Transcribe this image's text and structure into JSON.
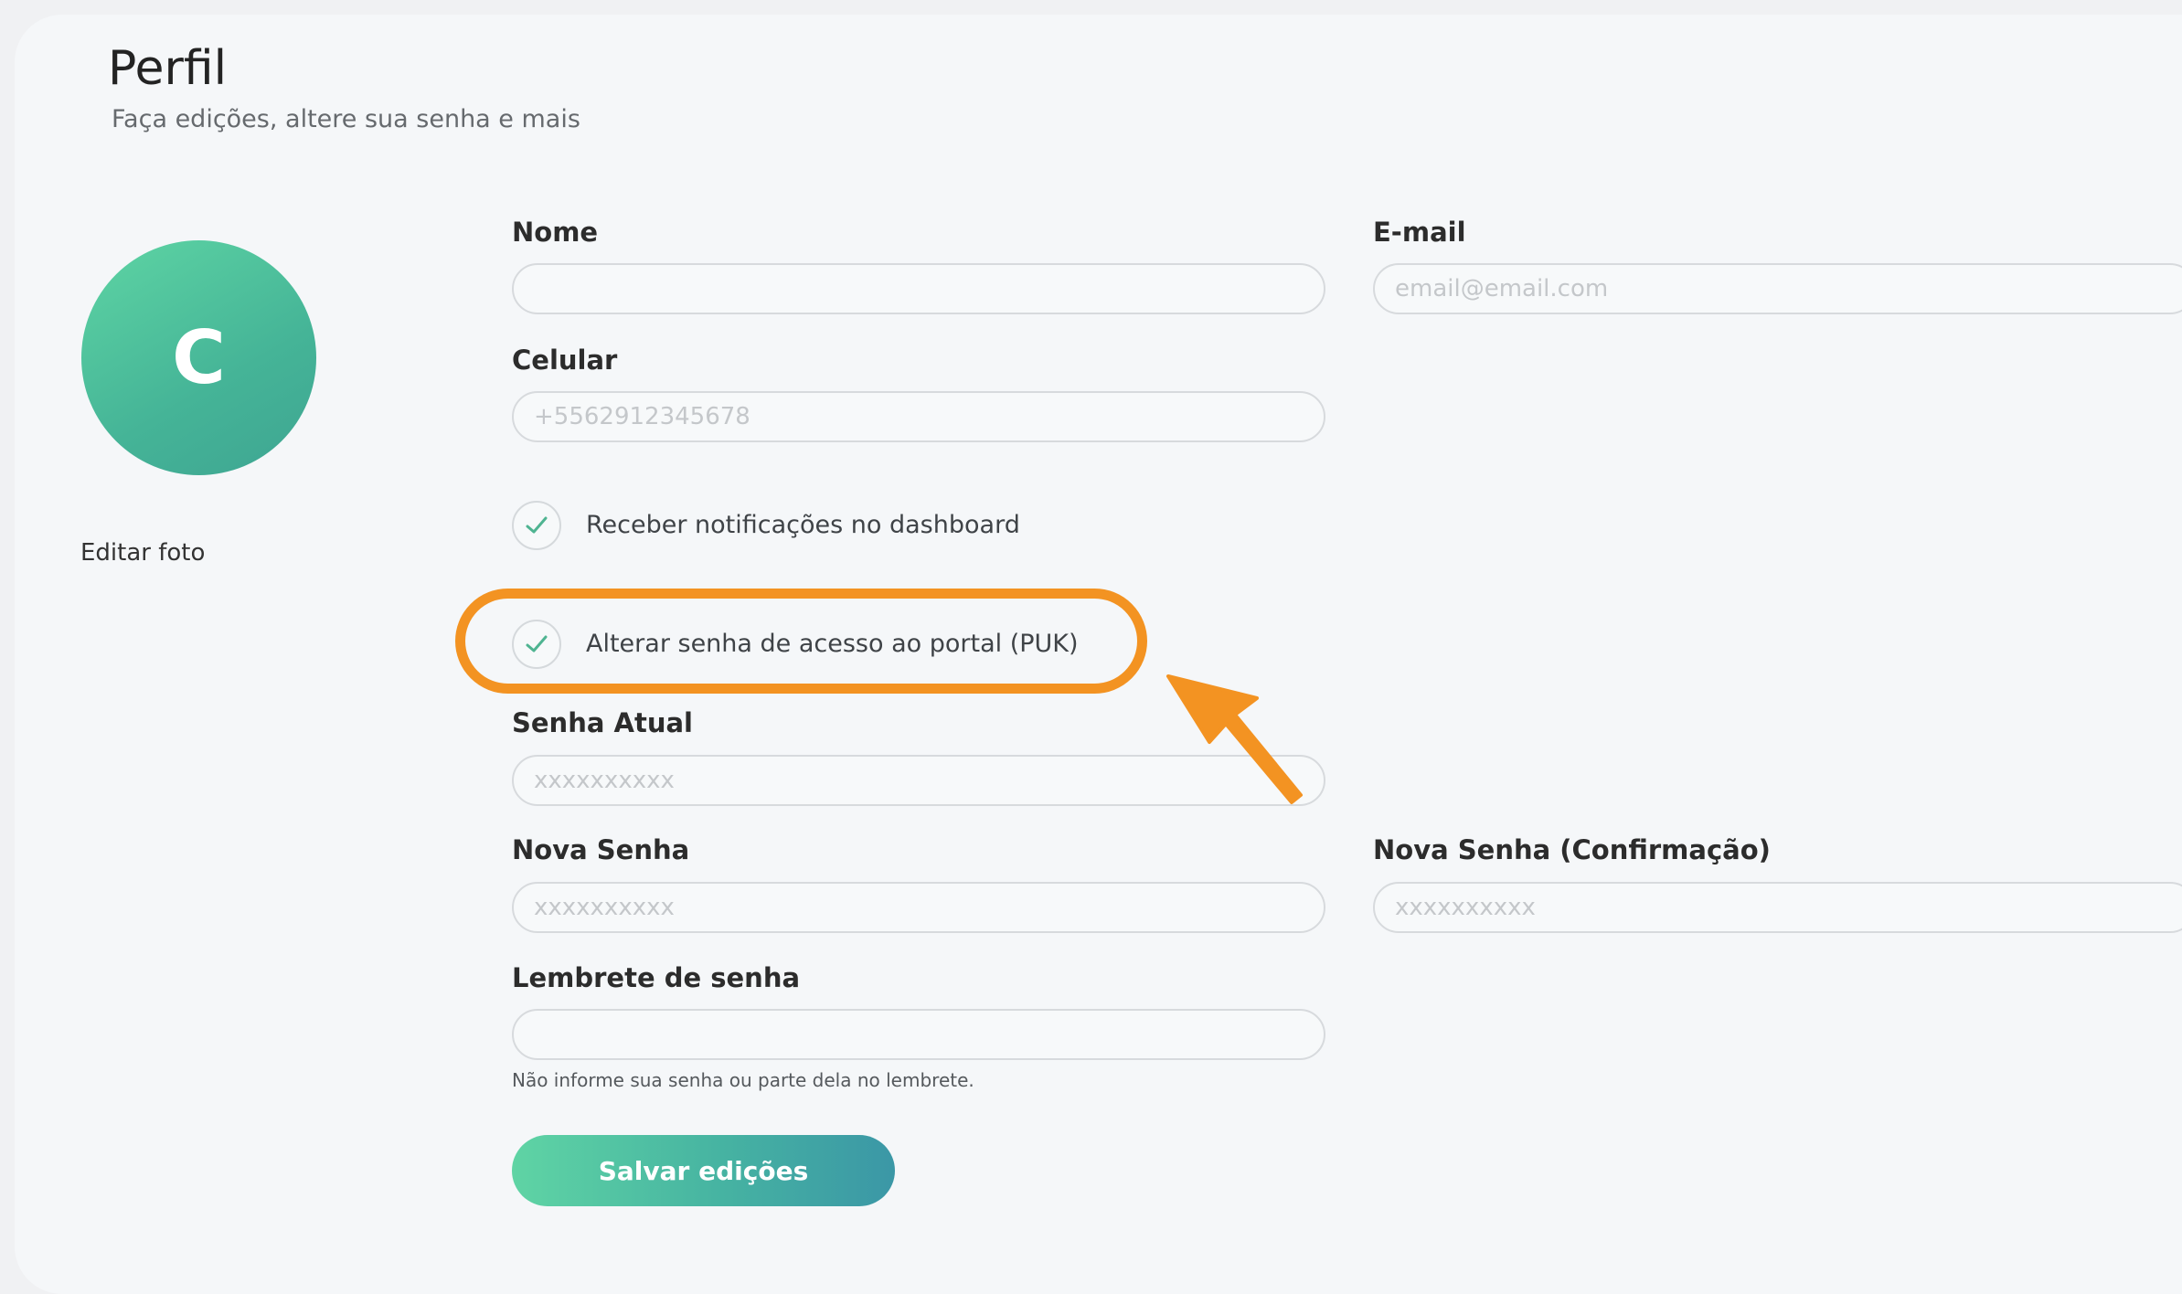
{
  "header": {
    "title": "Perfil",
    "subtitle": "Faça edições, altere sua senha e mais"
  },
  "avatar": {
    "initial": "C",
    "edit_label": "Editar foto"
  },
  "form": {
    "nome": {
      "label": "Nome",
      "value": "",
      "placeholder": ""
    },
    "email": {
      "label": "E-mail",
      "value": "",
      "placeholder": "email@email.com"
    },
    "celular": {
      "label": "Celular",
      "value": "",
      "placeholder": "+5562912345678"
    },
    "notify_checkbox": {
      "label": "Receber notificações no dashboard",
      "checked": true
    },
    "change_password_checkbox": {
      "label": "Alterar senha de acesso ao portal (PUK)",
      "checked": true
    },
    "senha_atual": {
      "label": "Senha Atual",
      "placeholder": "xxxxxxxxxx"
    },
    "nova_senha": {
      "label": "Nova Senha",
      "placeholder": "xxxxxxxxxx"
    },
    "nova_senha_confirmacao": {
      "label": "Nova Senha (Confirmação)",
      "placeholder": "xxxxxxxxxx"
    },
    "lembrete": {
      "label": "Lembrete de senha",
      "value": "",
      "hint": "Não informe sua senha ou parte dela no lembrete."
    },
    "save_label": "Salvar edições"
  },
  "annotation": {
    "highlight_color": "#f39322"
  },
  "colors": {
    "accent_green": "#4fc39c",
    "accent_teal": "#3b97a6"
  }
}
